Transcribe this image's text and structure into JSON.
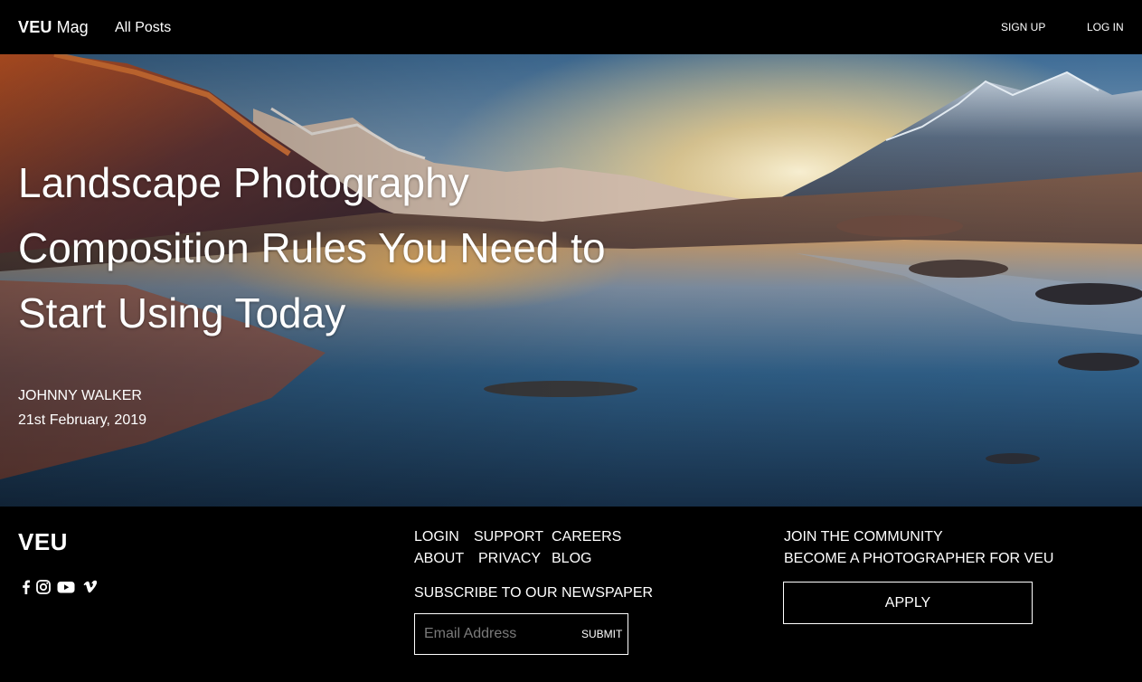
{
  "nav": {
    "brand_bold": "VEU",
    "brand_rest": "Mag",
    "all_posts": "All Posts",
    "sign_up": "SIGN UP",
    "log_in": "LOG IN"
  },
  "hero": {
    "title": "Landscape Photography Composition Rules You Need to Start Using Today",
    "author": "JOHNNY WALKER",
    "date": "21st February, 2019"
  },
  "footer": {
    "logo": "VEU",
    "social_icons": [
      "facebook-icon",
      "instagram-icon",
      "youtube-icon",
      "vimeo-icon"
    ],
    "links": {
      "login": "LOGIN",
      "support": "SUPPORT",
      "careers": "CAREERS",
      "about": "ABOUT",
      "privacy": "PRIVACY",
      "blog": "BLOG"
    },
    "subscribe_label": "SUBSCRIBE TO OUR NEWSPAPER",
    "email_placeholder": "Email Address",
    "submit_label": "SUBMIT",
    "join": "JOIN THE COMMUNITY",
    "become": "BECOME A PHOTOGRAPHER FOR VEU",
    "apply_label": "APPLY"
  },
  "colors": {
    "background": "#000000",
    "text": "#ffffff",
    "placeholder": "#7a7a7a"
  }
}
